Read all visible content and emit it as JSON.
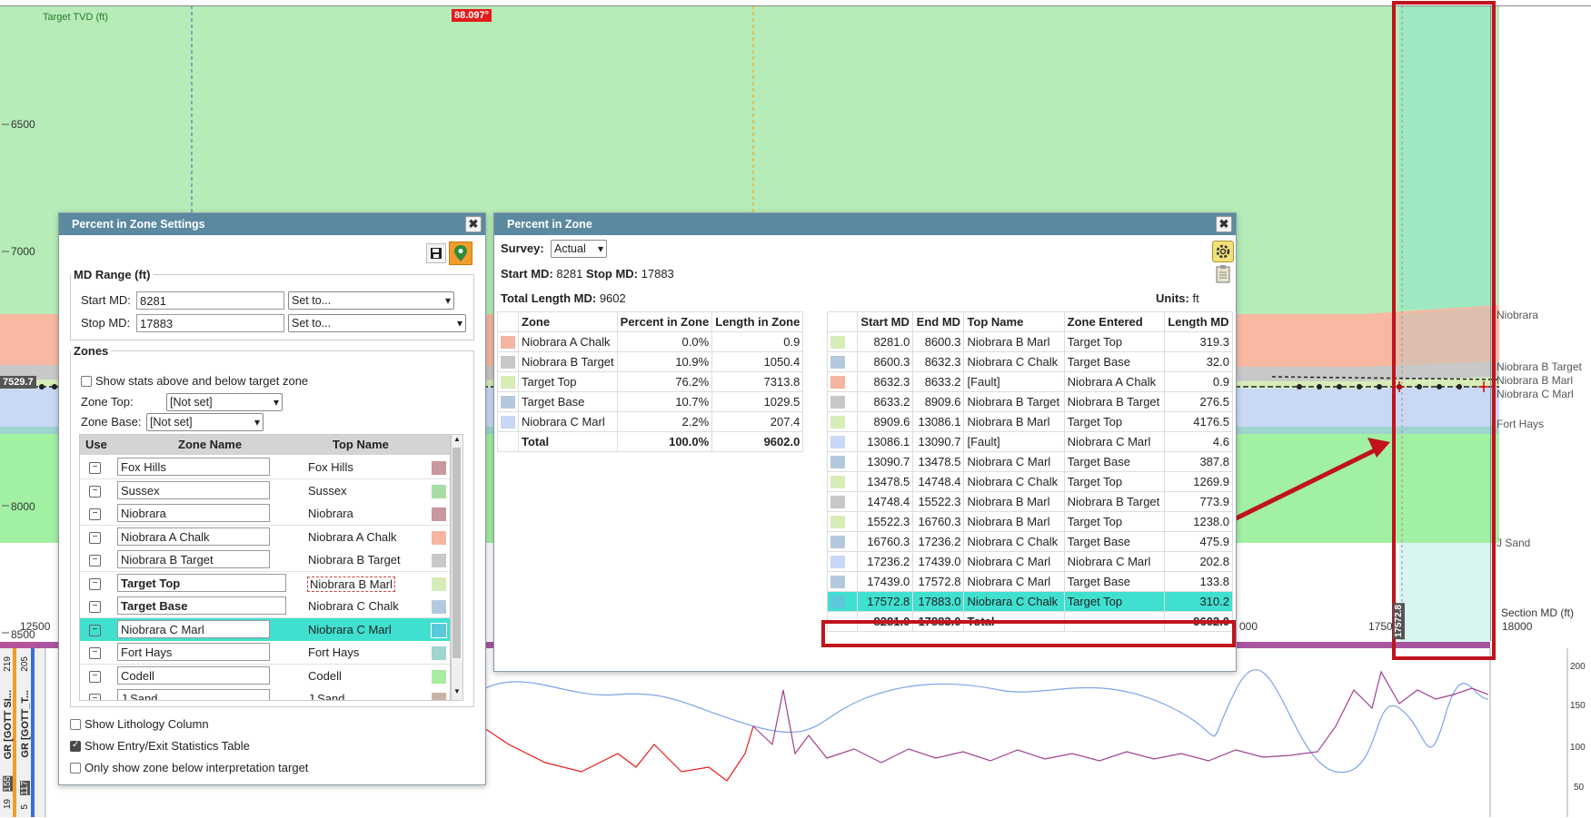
{
  "plot": {
    "title": "Target TVD (ft)",
    "angle": "88.097°",
    "depth_ticks": [
      "6500",
      "7000",
      "8000",
      "8500"
    ],
    "md_ticks": [
      "12500",
      "1750",
      "18000"
    ],
    "md_label_partial": "000",
    "section_md_label": "Section MD (ft)",
    "current_depth": "7529.7",
    "vertical_marker": "17572.8",
    "zone_labels": [
      "Niobrara",
      "Niobrara B Target",
      "Niobrara B Marl",
      "Niobrara C Marl",
      "Fort Hays",
      "J Sand"
    ],
    "log_ticks": [
      "200",
      "150",
      "100",
      "50"
    ],
    "track_labels": [
      "GR [GOTT SI...",
      "GR [GOTT_T...",
      "219",
      "205",
      "155",
      "117",
      "19",
      "5"
    ]
  },
  "settings_dialog": {
    "title": "Percent in Zone Settings",
    "save_icon": "save-icon",
    "pin_icon": "map-pin-icon",
    "md_range": {
      "legend": "MD Range (ft)",
      "start_label": "Start MD:",
      "start_value": "8281",
      "start_set": "Set to...",
      "stop_label": "Stop MD:",
      "stop_value": "17883",
      "stop_set": "Set to..."
    },
    "zones": {
      "legend": "Zones",
      "show_stats_label": "Show stats above and below target zone",
      "zone_top_label": "Zone Top:",
      "zone_top_value": "[Not set]",
      "zone_base_label": "Zone Base:",
      "zone_base_value": "[Not set]",
      "headers": [
        "Use",
        "Zone Name",
        "Top Name"
      ],
      "rows": [
        {
          "name": "Fox Hills",
          "top": "Fox Hills",
          "color": "#c9979c",
          "bold": false,
          "selected": false
        },
        {
          "name": "Sussex",
          "top": "Sussex",
          "color": "#a9dca4",
          "bold": false,
          "selected": false
        },
        {
          "name": "Niobrara",
          "top": "Niobrara",
          "color": "#c9979c",
          "bold": false,
          "selected": false
        },
        {
          "name": "Niobrara A Chalk",
          "top": "Niobrara A Chalk",
          "color": "#f5b5a0",
          "bold": false,
          "selected": false
        },
        {
          "name": "Niobrara B Target",
          "top": "Niobrara B Target",
          "color": "#c8c8c8",
          "bold": false,
          "selected": false
        },
        {
          "name": "Target Top",
          "top": "Niobrara B Marl",
          "color": "#d6edb8",
          "bold": true,
          "selected": false
        },
        {
          "name": "Target Base",
          "top": "Niobrara C Chalk",
          "color": "#b5c9de",
          "bold": true,
          "selected": false
        },
        {
          "name": "Niobrara C Marl",
          "top": "Niobrara C Marl",
          "color": "#5bc8dc",
          "bold": false,
          "selected": true
        },
        {
          "name": "Fort Hays",
          "top": "Fort Hays",
          "color": "#9fd4cf",
          "bold": false,
          "selected": false
        },
        {
          "name": "Codell",
          "top": "Codell",
          "color": "#a8eda0",
          "bold": false,
          "selected": false
        },
        {
          "name": "J Sand",
          "top": "J Sand",
          "color": "#c9b3a6",
          "bold": false,
          "selected": false
        }
      ]
    },
    "show_lithology": "Show Lithology Column",
    "show_entry_exit": "Show Entry/Exit Statistics Table",
    "only_show_below": "Only show zone below interpretation target"
  },
  "piz_dialog": {
    "title": "Percent in Zone",
    "survey_label": "Survey:",
    "survey_value": "Actual",
    "start_md_label": "Start MD:",
    "start_md": "8281",
    "stop_md_label": "Stop MD:",
    "stop_md": "17883",
    "total_length_label": "Total Length MD:",
    "total_length": "9602",
    "units_label": "Units:",
    "units": "ft",
    "gear_icon": "gear-icon",
    "clipboard_icon": "clipboard-icon",
    "summary_headers": [
      "Zone",
      "Percent in Zone",
      "Length in Zone"
    ],
    "summary_rows": [
      {
        "color": "#f5b5a0",
        "zone": "Niobrara A Chalk",
        "pct": "0.0%",
        "len": "0.9"
      },
      {
        "color": "#c8c8c8",
        "zone": "Niobrara B Target",
        "pct": "10.9%",
        "len": "1050.4"
      },
      {
        "color": "#d6edb8",
        "zone": "Target Top",
        "pct": "76.2%",
        "len": "7313.8"
      },
      {
        "color": "#b5c9de",
        "zone": "Target Base",
        "pct": "10.7%",
        "len": "1029.5"
      },
      {
        "color": "#c9d8f5",
        "zone": "Niobrara C Marl",
        "pct": "2.2%",
        "len": "207.4"
      }
    ],
    "summary_total": {
      "zone": "Total",
      "pct": "100.0%",
      "len": "9602.0"
    },
    "detail_headers": [
      "Start MD",
      "End MD",
      "Top Name",
      "Zone Entered",
      "Length MD"
    ],
    "detail_rows": [
      {
        "color": "#d6edb8",
        "s": "8281.0",
        "e": "8600.3",
        "top": "Niobrara B Marl",
        "zone": "Target Top",
        "len": "319.3",
        "hl": false
      },
      {
        "color": "#b5c9de",
        "s": "8600.3",
        "e": "8632.3",
        "top": "Niobrara C Chalk",
        "zone": "Target Base",
        "len": "32.0",
        "hl": false
      },
      {
        "color": "#f5b5a0",
        "s": "8632.3",
        "e": "8633.2",
        "top": "[Fault]",
        "zone": "Niobrara A Chalk",
        "len": "0.9",
        "hl": false
      },
      {
        "color": "#c8c8c8",
        "s": "8633.2",
        "e": "8909.6",
        "top": "Niobrara B Target",
        "zone": "Niobrara B Target",
        "len": "276.5",
        "hl": false
      },
      {
        "color": "#d6edb8",
        "s": "8909.6",
        "e": "13086.1",
        "top": "Niobrara B Marl",
        "zone": "Target Top",
        "len": "4176.5",
        "hl": false
      },
      {
        "color": "#c9d8f5",
        "s": "13086.1",
        "e": "13090.7",
        "top": "[Fault]",
        "zone": "Niobrara C Marl",
        "len": "4.6",
        "hl": false
      },
      {
        "color": "#b5c9de",
        "s": "13090.7",
        "e": "13478.5",
        "top": "Niobrara C Marl",
        "zone": "Target Base",
        "len": "387.8",
        "hl": false
      },
      {
        "color": "#d6edb8",
        "s": "13478.5",
        "e": "14748.4",
        "top": "Niobrara C Chalk",
        "zone": "Target Top",
        "len": "1269.9",
        "hl": false
      },
      {
        "color": "#c8c8c8",
        "s": "14748.4",
        "e": "15522.3",
        "top": "Niobrara B Marl",
        "zone": "Niobrara B Target",
        "len": "773.9",
        "hl": false
      },
      {
        "color": "#d6edb8",
        "s": "15522.3",
        "e": "16760.3",
        "top": "Niobrara B Marl",
        "zone": "Target Top",
        "len": "1238.0",
        "hl": false
      },
      {
        "color": "#b5c9de",
        "s": "16760.3",
        "e": "17236.2",
        "top": "Niobrara C Chalk",
        "zone": "Target Base",
        "len": "475.9",
        "hl": false
      },
      {
        "color": "#c9d8f5",
        "s": "17236.2",
        "e": "17439.0",
        "top": "Niobrara C Marl",
        "zone": "Niobrara C Marl",
        "len": "202.8",
        "hl": false
      },
      {
        "color": "#b5c9de",
        "s": "17439.0",
        "e": "17572.8",
        "top": "Niobrara C Marl",
        "zone": "Target Base",
        "len": "133.8",
        "hl": false
      },
      {
        "color": "#5bc8dc",
        "s": "17572.8",
        "e": "17883.0",
        "top": "Niobrara C Chalk",
        "zone": "Target Top",
        "len": "310.2",
        "hl": true
      }
    ],
    "detail_total": {
      "s": "8281.0",
      "e": "17883.0",
      "top": "Total",
      "len": "9602.0"
    }
  }
}
